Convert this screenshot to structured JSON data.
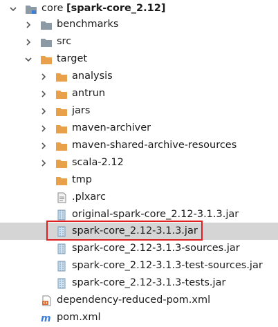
{
  "tree": {
    "root": {
      "name": "core",
      "module_label": "[spark-core_2.12]"
    },
    "items": [
      {
        "label": "benchmarks"
      },
      {
        "label": "src"
      },
      {
        "label": "target"
      },
      {
        "label": "analysis"
      },
      {
        "label": "antrun"
      },
      {
        "label": "jars"
      },
      {
        "label": "maven-archiver"
      },
      {
        "label": "maven-shared-archive-resources"
      },
      {
        "label": "scala-2.12"
      },
      {
        "label": "tmp"
      },
      {
        "label": ".plxarc"
      },
      {
        "label": "original-spark-core_2.12-3.1.3.jar"
      },
      {
        "label": "spark-core_2.12-3.1.3.jar"
      },
      {
        "label": "spark-core_2.12-3.1.3-sources.jar"
      },
      {
        "label": "spark-core_2.12-3.1.3-test-sources.jar"
      },
      {
        "label": "spark-core_2.12-3.1.3-tests.jar"
      },
      {
        "label": "dependency-reduced-pom.xml"
      },
      {
        "label": "pom.xml"
      }
    ]
  },
  "colors": {
    "folder_gray": "#8c9aa6",
    "folder_orange": "#e8a04a",
    "selection": "#d5d5d5",
    "highlight": "#e02020",
    "maven_blue": "#3d7fd8"
  }
}
